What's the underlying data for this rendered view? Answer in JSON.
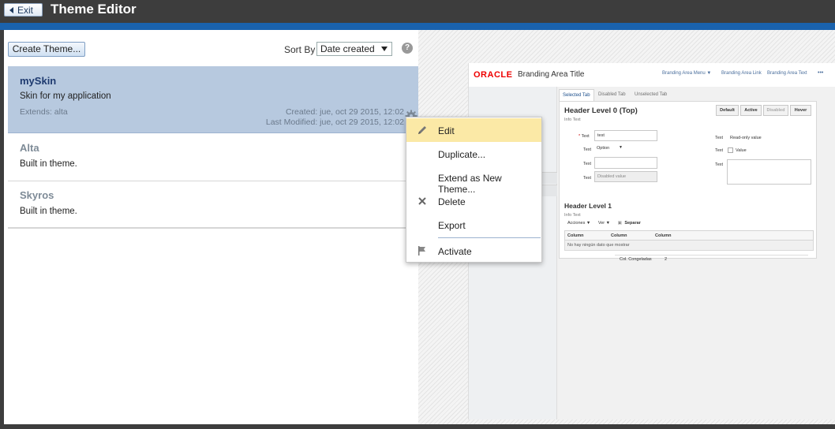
{
  "header": {
    "exit_label": "Exit",
    "title": "Theme Editor"
  },
  "toolbar": {
    "create_label": "Create Theme...",
    "sort_label": "Sort By",
    "sort_value": "Date created",
    "help_glyph": "?"
  },
  "themes": [
    {
      "name": "mySkin",
      "description": "Skin for my application",
      "extends": "Extends: alta",
      "created": "Created: jue, oct 29 2015, 12:02",
      "modified": "Last Modified: jue, oct 29 2015, 12:02",
      "selected": true
    },
    {
      "name": "Alta",
      "description": "Built in theme."
    },
    {
      "name": "Skyros",
      "description": "Built in theme."
    }
  ],
  "context_menu": {
    "items": [
      {
        "label": "Edit",
        "icon": "pencil-icon"
      },
      {
        "label": "Duplicate..."
      },
      {
        "label": "Extend as New Theme..."
      },
      {
        "label": "Delete",
        "icon": "close-icon"
      },
      {
        "label": "Export"
      },
      {
        "label": "Activate",
        "icon": "flag-icon"
      }
    ]
  },
  "preview": {
    "oracle": "ORACLE",
    "branding_title": "Branding Area Title",
    "branding_menu": "Branding Area Menu ▼",
    "branding_link": "Branding Area Link",
    "branding_text": "Branding Area Text",
    "tabs": [
      "Selected Tab",
      "Disabled Tab",
      "Unselected Tab"
    ],
    "header0": "Header Level 0 (Top)",
    "info0": "Info Text",
    "buttons": [
      "Default",
      "Active",
      "Disabled",
      "Hover"
    ],
    "fields": {
      "text_label": "Text",
      "text_value": "test",
      "option_value": "Option",
      "disabled_value": "Disabled value",
      "readonly_value": "Read-only value",
      "checkbox_label": "Value"
    },
    "header1": "Header Level 1",
    "info1": "Info Text",
    "table_toolbar": {
      "actions": "Acciones ▼",
      "view": "Ver ▼",
      "detach": "Separar"
    },
    "columns": [
      "Column",
      "Column",
      "Column"
    ],
    "empty_row": "No hay ningún dato que mostrar",
    "frozen_label": "Col. Congeladas",
    "frozen_value": "2"
  },
  "colors": {
    "accent": "#1a62ad",
    "selected_row": "#b7c9df",
    "menu_highlight": "#fbe9a6"
  }
}
